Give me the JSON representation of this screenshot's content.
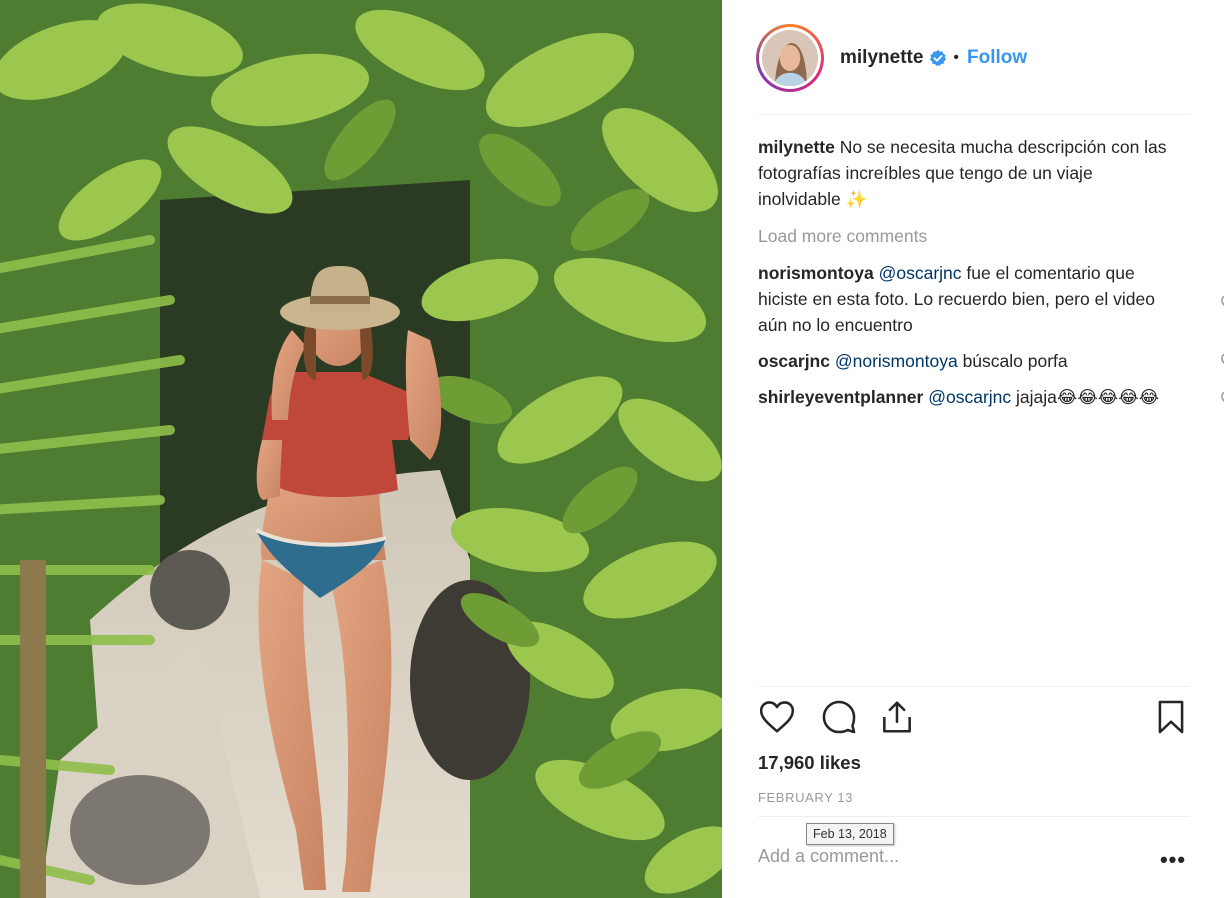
{
  "header": {
    "username": "milynette",
    "dot": "•",
    "follow_label": "Follow",
    "verified_icon": "verified-badge-icon"
  },
  "caption": {
    "author": "milynette",
    "text": "No se necesita mucha descripción con las fotografías increíbles que tengo de un viaje inolvidable",
    "emoji": "✨"
  },
  "load_more_label": "Load more comments",
  "comments": [
    {
      "author": "norismontoya",
      "mention": "@oscarjnc",
      "text": "fue el comentario que hiciste en esta foto. Lo recuerdo bien, pero el video aún no lo encuentro"
    },
    {
      "author": "oscarjnc",
      "mention": "@norismontoya",
      "text": "búscalo porfa"
    },
    {
      "author": "shirleyeventplanner",
      "mention": "@oscarjnc",
      "text": "jajaja😂😂😂😂😂"
    }
  ],
  "actions": {
    "like_icon": "heart-icon",
    "comment_icon": "comment-bubble-icon",
    "share_icon": "share-upload-icon",
    "save_icon": "bookmark-icon"
  },
  "likes_text": "17,960 likes",
  "date_text": "FEBRUARY 13",
  "tooltip_text": "Feb 13, 2018",
  "add_comment": {
    "placeholder": "Add a comment...",
    "value": ""
  },
  "more_options_label": "•••",
  "colors": {
    "link_blue": "#3897f0",
    "mention_navy": "#003569",
    "muted_gray": "#999999",
    "text": "#262626"
  }
}
